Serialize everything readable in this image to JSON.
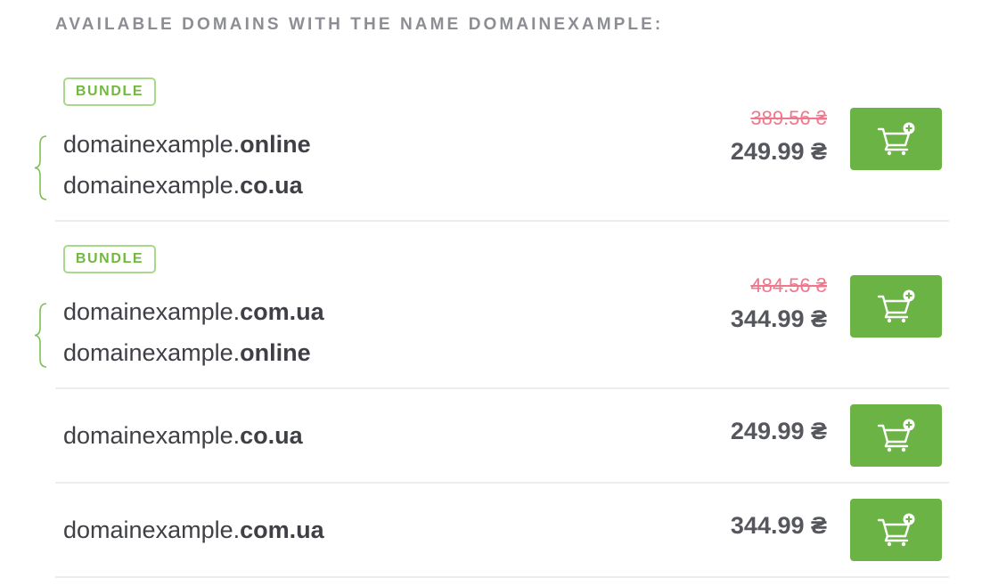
{
  "heading": "AVAILABLE DOMAINS WITH THE NAME DOMAINEXAMPLE:",
  "currency": "₴",
  "colors": {
    "accent": "#6ab344",
    "badge_text": "#72b83e",
    "old_price": "#f0768b"
  },
  "rows": [
    {
      "badge": "BUNDLE",
      "domains": [
        {
          "name": "domainexample.",
          "tld": "online"
        },
        {
          "name": "domainexample.",
          "tld": "co.ua"
        }
      ],
      "old_price": "389.56 ₴",
      "price": "249.99 ₴",
      "icon": "add-to-cart-icon"
    },
    {
      "badge": "BUNDLE",
      "domains": [
        {
          "name": "domainexample.",
          "tld": "com.ua"
        },
        {
          "name": "domainexample.",
          "tld": "online"
        }
      ],
      "old_price": "484.56 ₴",
      "price": "344.99 ₴",
      "icon": "add-to-cart-icon"
    },
    {
      "domains": [
        {
          "name": "domainexample.",
          "tld": "co.ua"
        }
      ],
      "price": "249.99 ₴",
      "icon": "add-to-cart-icon"
    },
    {
      "domains": [
        {
          "name": "domainexample.",
          "tld": "com.ua"
        }
      ],
      "price": "344.99 ₴",
      "icon": "add-to-cart-icon"
    }
  ]
}
